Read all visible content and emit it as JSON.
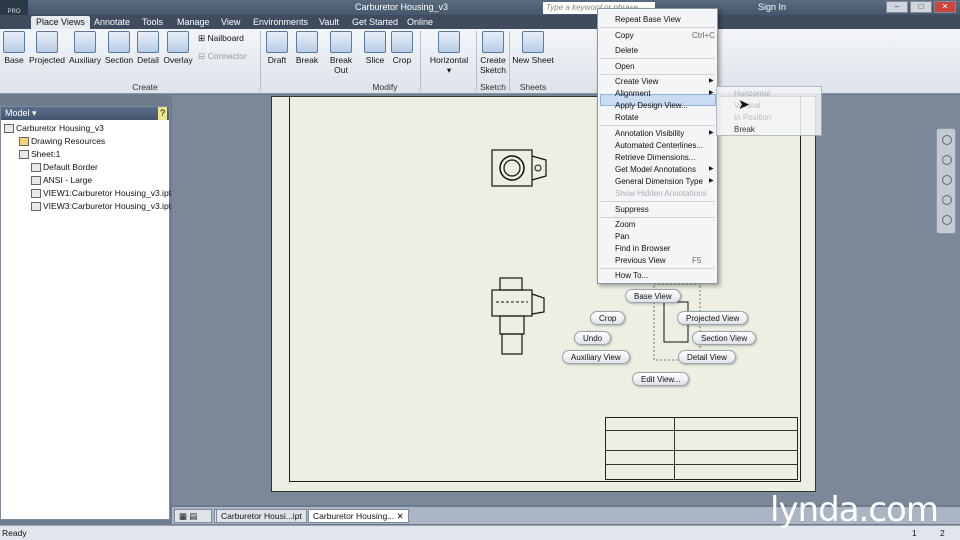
{
  "window": {
    "title": "Carburetor Housing_v3",
    "search_placeholder": "Type a keyword or phrase",
    "signin": "Sign In",
    "logo": "PRO"
  },
  "tabs": [
    "Place Views",
    "Annotate",
    "Tools",
    "Manage",
    "View",
    "Environments",
    "Vault",
    "Get Started",
    "Online"
  ],
  "ribbon": {
    "create": [
      "Base",
      "Projected",
      "Auxiliary",
      "Section",
      "Detail",
      "Overlay"
    ],
    "nailboard": "Nailboard",
    "connector": "Connector",
    "modify": [
      "Draft",
      "Break",
      "Break Out",
      "Slice",
      "Crop"
    ],
    "horizontal": "Horizontal",
    "create_sketch_1": "Create",
    "create_sketch_2": "Sketch",
    "new_sheet": "New Sheet",
    "groups": [
      "Create",
      "Modify",
      "Sketch",
      "Sheets"
    ]
  },
  "browser": {
    "title": "Model",
    "help": "?",
    "nodes": [
      "Carburetor Housing_v3",
      "Drawing Resources",
      "Sheet:1",
      "Default Border",
      "ANSI - Large",
      "VIEW1:Carburetor Housing_v3.ipt",
      "VIEW3:Carburetor Housing_v3.ipt"
    ]
  },
  "context_menu": [
    {
      "label": "Repeat Base View",
      "enabled": true
    },
    {
      "label": "Copy",
      "shortcut": "Ctrl+C",
      "enabled": true
    },
    {
      "label": "Delete",
      "enabled": true
    },
    {
      "label": "Open",
      "enabled": true
    },
    {
      "label": "Create View",
      "enabled": true,
      "submenu": true
    },
    {
      "label": "Alignment",
      "enabled": true,
      "submenu": true,
      "highlighted": true
    },
    {
      "label": "Apply Design View...",
      "enabled": true
    },
    {
      "label": "Rotate",
      "enabled": true
    },
    {
      "label": "Annotation Visibility",
      "enabled": true,
      "submenu": true
    },
    {
      "label": "Automated Centerlines...",
      "enabled": true
    },
    {
      "label": "Retrieve Dimensions...",
      "enabled": true
    },
    {
      "label": "Get Model Annotations",
      "enabled": true,
      "submenu": true
    },
    {
      "label": "General Dimension Type",
      "enabled": true,
      "submenu": true
    },
    {
      "label": "Show Hidden Annotations",
      "enabled": false
    },
    {
      "label": "Suppress",
      "enabled": true
    },
    {
      "label": "Zoom",
      "enabled": true
    },
    {
      "label": "Pan",
      "enabled": true
    },
    {
      "label": "Find in Browser",
      "enabled": true
    },
    {
      "label": "Previous View",
      "shortcut": "F5",
      "enabled": true
    },
    {
      "label": "How To...",
      "enabled": true
    }
  ],
  "alignment_submenu": [
    "Horizontal",
    "Vertical",
    "In Position",
    "Break"
  ],
  "marking_menu": [
    "Base View",
    "Crop",
    "Projected View",
    "Undo",
    "Section View",
    "Auxiliary View",
    "Detail View",
    "Edit View..."
  ],
  "doc_tabs": [
    "Carburetor Housi...ipt",
    "Carburetor Housing..."
  ],
  "status": {
    "left": "Ready",
    "n1": "1",
    "n2": "2"
  },
  "watermark": "lynda.com"
}
